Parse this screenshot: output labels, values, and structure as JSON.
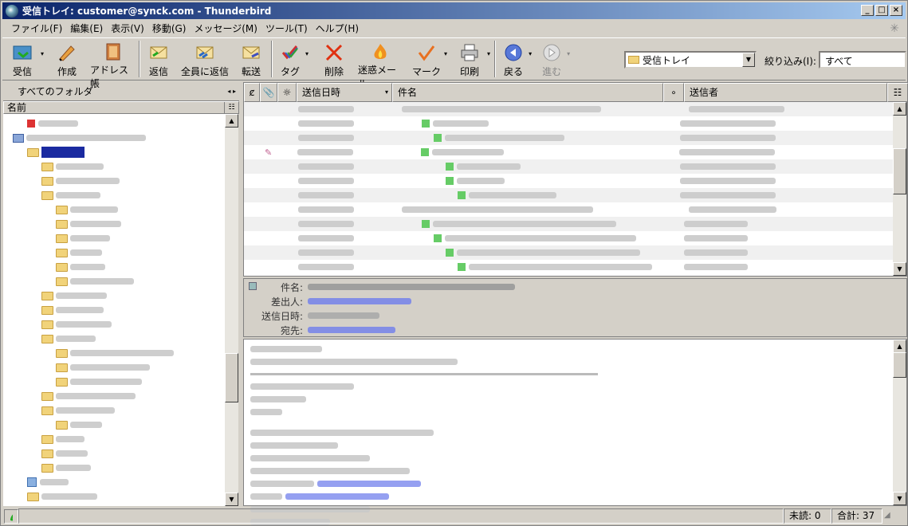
{
  "window": {
    "title": "受信トレイ: customer@synck.com - Thunderbird",
    "buttons": [
      "_",
      "□",
      "×"
    ]
  },
  "menu": [
    {
      "label": "ファイル(F)"
    },
    {
      "label": "編集(E)"
    },
    {
      "label": "表示(V)"
    },
    {
      "label": "移動(G)"
    },
    {
      "label": "メッセージ(M)"
    },
    {
      "label": "ツール(T)"
    },
    {
      "label": "ヘルプ(H)"
    }
  ],
  "toolbar": {
    "get_mail": "受信",
    "write": "作成",
    "address_book": "アドレス帳",
    "reply": "返信",
    "reply_all": "全員に返信",
    "forward": "転送",
    "tag": "タグ",
    "delete": "削除",
    "junk": "迷惑メール",
    "mark": "マーク",
    "print": "印刷",
    "back": "戻る",
    "forward_nav": "進む",
    "folder_combo": "受信トレイ",
    "filter_label": "絞り込み(I):",
    "filter_value": "すべて"
  },
  "folder_pane": {
    "header": "すべてのフォルダ",
    "column": "名前",
    "picker": "☷"
  },
  "thread_pane": {
    "columns": {
      "thread": "ȼ",
      "attachment": "📎",
      "junk": "☼",
      "date": "送信日時",
      "subject": "件名",
      "read": "∘",
      "sender": "送信者",
      "picker": "☷"
    }
  },
  "message_header": {
    "subject_label": "件名:",
    "from_label": "差出人:",
    "date_label": "送信日時:",
    "to_label": "宛先:"
  },
  "status": {
    "unread": "未読: 0",
    "total": "合計: 37"
  },
  "colors": {
    "titlebar_start": "#0a246a",
    "titlebar_end": "#a6caf0",
    "chrome": "#d4d0c8",
    "link": "#3344ff"
  }
}
